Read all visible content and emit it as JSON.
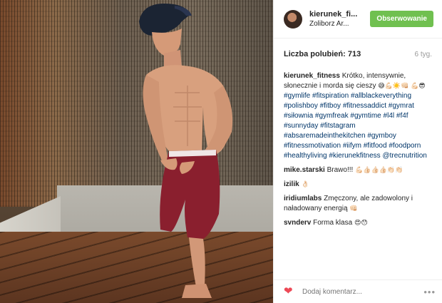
{
  "post": {
    "photo_alt": "",
    "header": {
      "username": "kierunek_fi...",
      "location": "Żoliborz Ar...",
      "follow_label": "Obserwowanie"
    },
    "likes": {
      "label": "Liczba polubień: 713",
      "time_ago": "6 tyg."
    },
    "caption": {
      "user": "kierunek_fitness",
      "text_1": "Krótko, intensywnie, słonecznie i morda się cieszy",
      "emoji_1": "😅💪🏻☀️👊🏻",
      "emoji_2": "💪🏻😎",
      "hashtags": [
        "#gymlife",
        "#fitspiration",
        "#allblackeverything",
        "#polishboy",
        "#fitboy",
        "#fitnessaddict",
        "#gymrat",
        "#siłownia",
        "#gymfreak",
        "#gymtime",
        "#l4l",
        "#f4f",
        "#sunnyday",
        "#fitstagram",
        "#absaremadeinthekitchen",
        "#gymboy",
        "#fitnessmotivation",
        "#iifym",
        "#fitfood",
        "#foodporn",
        "#healthyliving",
        "#kierunekfitness",
        "@trecnutrition"
      ]
    },
    "comments": [
      {
        "user": "mike.starski",
        "text": "Brawo!!!",
        "emoji": "💪🏻👍🏻👍🏻👍🏻👏🏻👏🏻"
      },
      {
        "user": "izilik",
        "text": "",
        "emoji": "👌🏻"
      },
      {
        "user": "iridiumlabs",
        "text": "Zmęczony, ale zadowolony i naładowany energią",
        "emoji": "👊🏻"
      },
      {
        "user": "svnderv",
        "text": "Forma klasa",
        "emoji": "😍😯"
      }
    ],
    "footer": {
      "comment_placeholder": "Dodaj komentarz...",
      "heart_icon": "heart-icon",
      "more_icon": "more-icon"
    }
  },
  "colors": {
    "follow_green": "#70c050",
    "hashtag_blue": "#003569",
    "heart_red": "#ed4956"
  }
}
